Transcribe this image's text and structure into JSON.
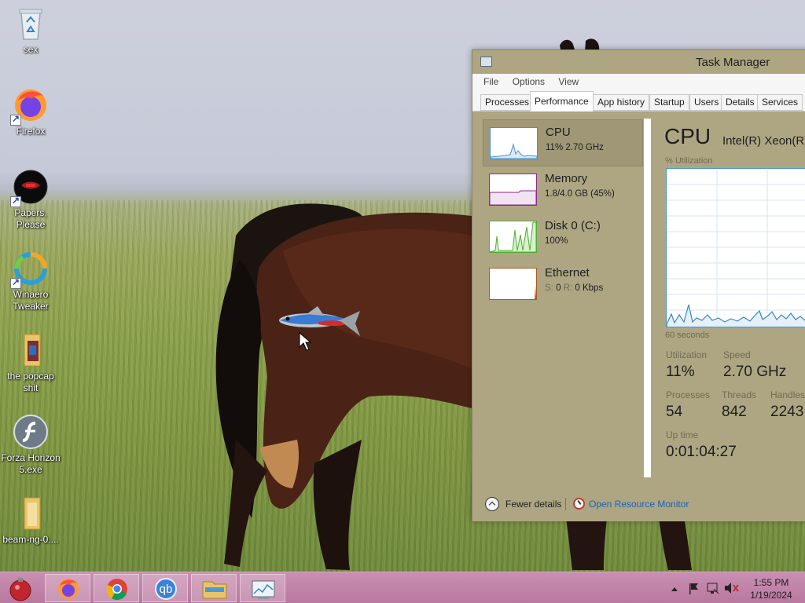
{
  "desktop": {
    "icons": [
      {
        "label": "sex",
        "icon": "recycle-bin-icon"
      },
      {
        "label": "Firefox",
        "icon": "firefox-icon"
      },
      {
        "label": "Papers, Please",
        "icon": "papers-please-icon"
      },
      {
        "label": "Winaero Tweaker",
        "icon": "winaero-tweaker-icon"
      },
      {
        "label": "the popcap shit",
        "icon": "folder-icon"
      },
      {
        "label": "Forza Horizon 5.exe",
        "icon": "flash-icon"
      },
      {
        "label": "beam-ng-0....",
        "icon": "folder-icon"
      }
    ]
  },
  "task_manager": {
    "title": "Task Manager",
    "menu": [
      "File",
      "Options",
      "View"
    ],
    "tabs": [
      "Processes",
      "Performance",
      "App history",
      "Startup",
      "Users",
      "Details",
      "Services"
    ],
    "active_tab": "Performance",
    "resources": [
      {
        "name": "CPU",
        "value": "11% 2.70 GHz",
        "color": "#4a92c9"
      },
      {
        "name": "Memory",
        "value": "1.8/4.0 GB (45%)",
        "color": "#8b2a8b"
      },
      {
        "name": "Disk 0 (C:)",
        "value": "100%",
        "color": "#4caf2c"
      },
      {
        "name": "Ethernet",
        "value_prefix": "S:",
        "value_s": "0",
        "value_r_prefix": "R:",
        "value": "0 Kbps",
        "color": "#a75a1c"
      }
    ],
    "detail": {
      "heading": "CPU",
      "model": "Intel(R) Xeon(R)",
      "utilization_caption": "% Utilization",
      "time_caption": "60 seconds",
      "stats": {
        "utilization_label": "Utilization",
        "utilization": "11%",
        "speed_label": "Speed",
        "speed": "2.70 GHz",
        "processes_label": "Processes",
        "processes": "54",
        "threads_label": "Threads",
        "threads": "842",
        "handles_label": "Handles",
        "handles": "2243",
        "uptime_label": "Up time",
        "uptime": "0:01:04:27"
      }
    },
    "footer": {
      "fewer_details": "Fewer details",
      "open_resource_monitor": "Open Resource Monitor"
    }
  },
  "taskbar": {
    "pinned": [
      "firefox-icon",
      "chrome-icon",
      "qbittorrent-icon",
      "file-explorer-icon",
      "task-manager-icon"
    ],
    "qbittorrent_label": "qb",
    "clock": {
      "time": "1:55 PM",
      "date": "1/19/2024"
    }
  }
}
